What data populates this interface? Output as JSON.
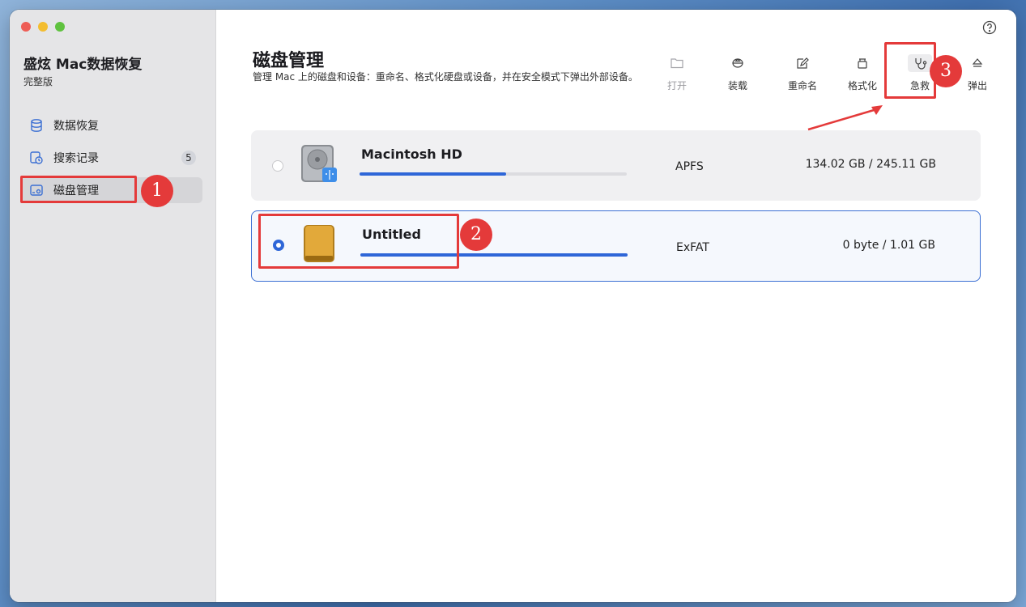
{
  "sidebar": {
    "app_name": "盛炫 Mac数据恢复",
    "edition": "完整版",
    "items": [
      {
        "label": "数据恢复",
        "icon": "database-icon"
      },
      {
        "label": "搜索记录",
        "icon": "history-icon",
        "badge": "5"
      },
      {
        "label": "磁盘管理",
        "icon": "disk-icon",
        "active": true
      }
    ]
  },
  "header": {
    "title": "磁盘管理",
    "description": "管理 Mac 上的磁盘和设备：重命名、格式化硬盘或设备，并在安全模式下弹出外部设备。"
  },
  "toolbar": {
    "open_label": "打开",
    "mount_label": "装载",
    "rename_label": "重命名",
    "format_label": "格式化",
    "rescue_label": "急救",
    "eject_label": "弹出"
  },
  "disks": [
    {
      "name": "Macintosh HD",
      "fs": "APFS",
      "capacity": "134.02 GB / 245.11 GB",
      "usage": 0.547,
      "selected": false
    },
    {
      "name": "Untitled",
      "fs": "ExFAT",
      "capacity": "0 byte / 1.01 GB",
      "usage": 1.0,
      "selected": true
    }
  ],
  "annotations": {
    "step1": "1",
    "step2": "2",
    "step3": "3",
    "color": "#e43a3a"
  },
  "colors": {
    "accent": "#2e66d8",
    "sidebar_bg": "#e5e5e7"
  }
}
